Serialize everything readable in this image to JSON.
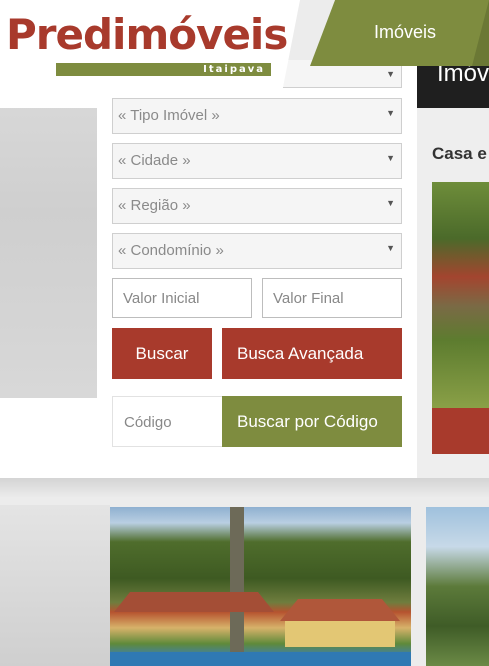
{
  "brand": {
    "name": "Predimóveis",
    "sub": "Itaipava",
    "color_primary": "#a83a2c",
    "color_secondary": "#7e8c3f"
  },
  "nav": {
    "imoveis_label": "Imóveis"
  },
  "search": {
    "tipo_imovel": "« Tipo Imóvel »",
    "cidade": "« Cidade »",
    "regiao": "« Região »",
    "condominio": "« Condomínio »",
    "valor_inicial_placeholder": "Valor Inicial",
    "valor_final_placeholder": "Valor Final",
    "buscar_label": "Buscar",
    "busca_avancada_label": "Busca Avançada",
    "codigo_placeholder": "Código",
    "buscar_codigo_label": "Buscar por Código"
  },
  "featured": {
    "header_text": "Imóv",
    "title": "Casa e"
  }
}
